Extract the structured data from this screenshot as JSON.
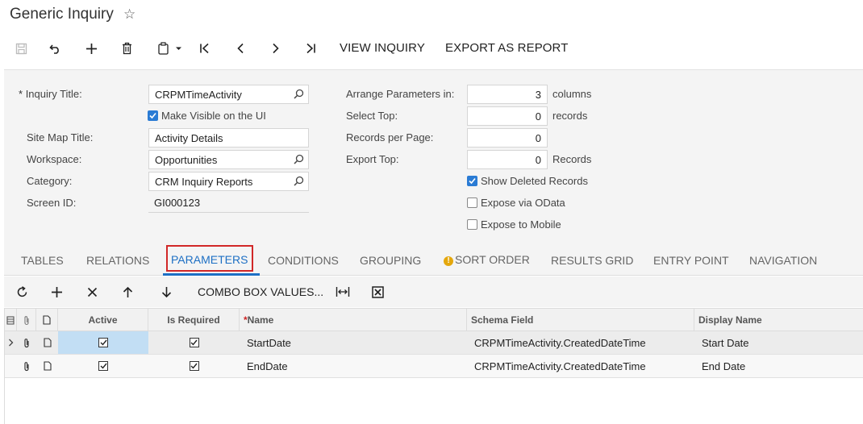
{
  "page": {
    "title": "Generic Inquiry"
  },
  "toolbar": {
    "view_inquiry": "VIEW INQUIRY",
    "export_as_report": "EXPORT AS REPORT"
  },
  "form": {
    "inquiry_title": {
      "label": "Inquiry Title:",
      "required_mark": "*",
      "value": "CRPMTimeActivity"
    },
    "make_visible": {
      "label": "Make Visible on the UI",
      "checked": true
    },
    "site_map_title": {
      "label": "Site Map Title:",
      "value": "Activity Details"
    },
    "workspace": {
      "label": "Workspace:",
      "value": "Opportunities"
    },
    "category": {
      "label": "Category:",
      "value": "CRM Inquiry Reports"
    },
    "screen_id": {
      "label": "Screen ID:",
      "value": "GI000123"
    },
    "arrange_parameters": {
      "label": "Arrange Parameters in:",
      "value": "3",
      "unit": "columns"
    },
    "select_top": {
      "label": "Select Top:",
      "value": "0",
      "unit": "records"
    },
    "records_per_page": {
      "label": "Records per Page:",
      "value": "0"
    },
    "export_top": {
      "label": "Export Top:",
      "value": "0",
      "unit": "Records"
    },
    "show_deleted": {
      "label": "Show Deleted Records",
      "checked": true
    },
    "expose_odata": {
      "label": "Expose via OData",
      "checked": false
    },
    "expose_mobile": {
      "label": "Expose to Mobile",
      "checked": false
    }
  },
  "tabs": [
    {
      "label": "TABLES"
    },
    {
      "label": "RELATIONS"
    },
    {
      "label": "PARAMETERS",
      "active": true
    },
    {
      "label": "CONDITIONS"
    },
    {
      "label": "GROUPING"
    },
    {
      "label": "SORT ORDER",
      "warning": "!"
    },
    {
      "label": "RESULTS GRID"
    },
    {
      "label": "ENTRY POINT"
    },
    {
      "label": "NAVIGATION"
    }
  ],
  "grid_toolbar": {
    "combo_box_values": "COMBO BOX VALUES..."
  },
  "grid": {
    "columns": {
      "active": "Active",
      "is_required": "Is Required",
      "name": "Name",
      "name_required_mark": "*",
      "schema_field": "Schema Field",
      "display_name": "Display Name"
    },
    "rows": [
      {
        "active": true,
        "is_required": true,
        "name": "StartDate",
        "schema_field": "CRPMTimeActivity.CreatedDateTime",
        "display_name": "Start Date"
      },
      {
        "active": true,
        "is_required": true,
        "name": "EndDate",
        "schema_field": "CRPMTimeActivity.CreatedDateTime",
        "display_name": "End Date"
      }
    ]
  },
  "colors": {
    "accent": "#1d6fc4",
    "highlight_box": "#d12828",
    "selected_cell": "#c2def4",
    "warning": "#e4a70c"
  }
}
